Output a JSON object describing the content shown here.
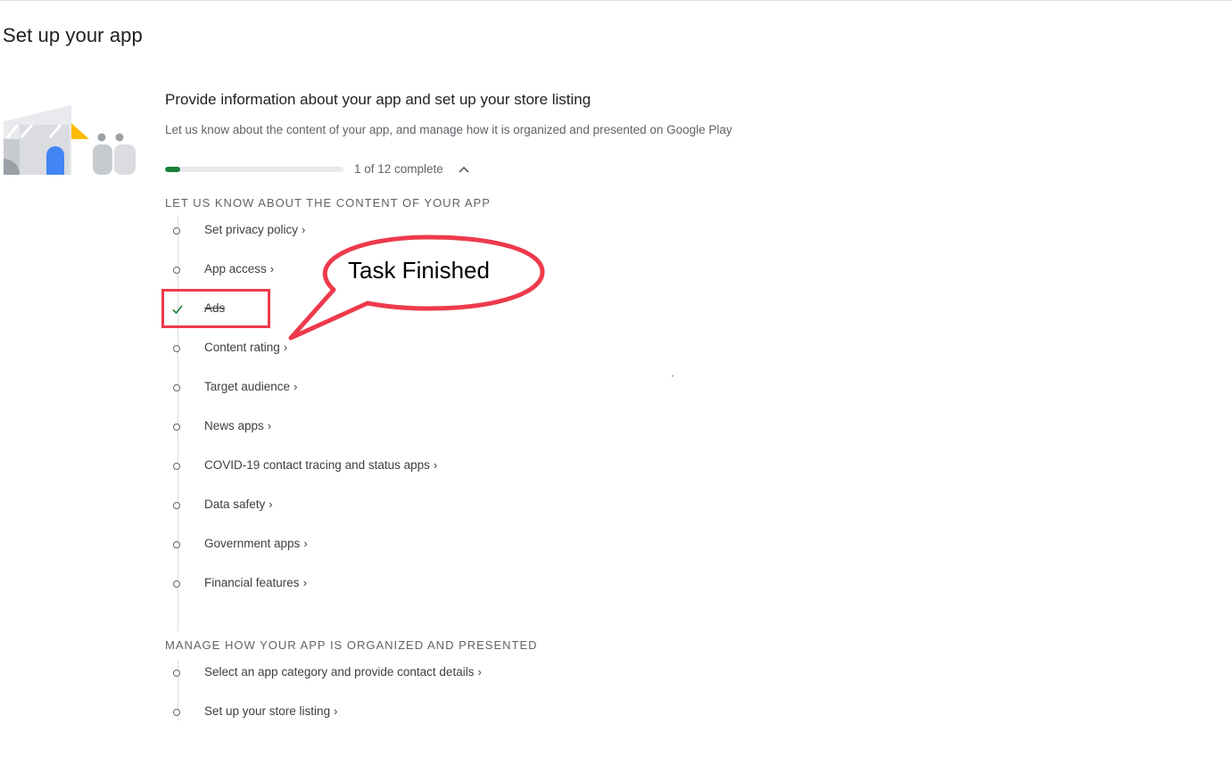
{
  "page": {
    "title": "Set up your app"
  },
  "section": {
    "heading": "Provide information about your app and set up your store listing",
    "description": "Let us know about the content of your app, and manage how it is organized and presented on Google Play",
    "progress_text": "1 of 12 complete",
    "progress_fraction": 0.0833,
    "colors": {
      "progress_fill": "#188038",
      "progress_track": "#e8eaed",
      "check": "#188038"
    }
  },
  "groups": [
    {
      "title": "LET US KNOW ABOUT THE CONTENT OF YOUR APP",
      "tasks": [
        {
          "label": "Set privacy policy",
          "done": false
        },
        {
          "label": "App access",
          "done": false
        },
        {
          "label": "Ads",
          "done": true
        },
        {
          "label": "Content rating",
          "done": false
        },
        {
          "label": "Target audience",
          "done": false
        },
        {
          "label": "News apps",
          "done": false
        },
        {
          "label": "COVID-19 contact tracing and status apps",
          "done": false
        },
        {
          "label": "Data safety",
          "done": false
        },
        {
          "label": "Government apps",
          "done": false
        },
        {
          "label": "Financial features",
          "done": false
        }
      ]
    },
    {
      "title": "MANAGE HOW YOUR APP IS ORGANIZED AND PRESENTED",
      "tasks": [
        {
          "label": "Select an app category and provide contact details",
          "done": false
        },
        {
          "label": "Set up your store listing",
          "done": false
        }
      ]
    }
  ],
  "annotation": {
    "callout_text": "Task Finished",
    "color": "#ee3a4c"
  },
  "icons": {
    "collapse": "chevron-up-icon",
    "task_chevron": "chevron-right-icon",
    "done": "check-icon",
    "pending": "circle-icon"
  }
}
